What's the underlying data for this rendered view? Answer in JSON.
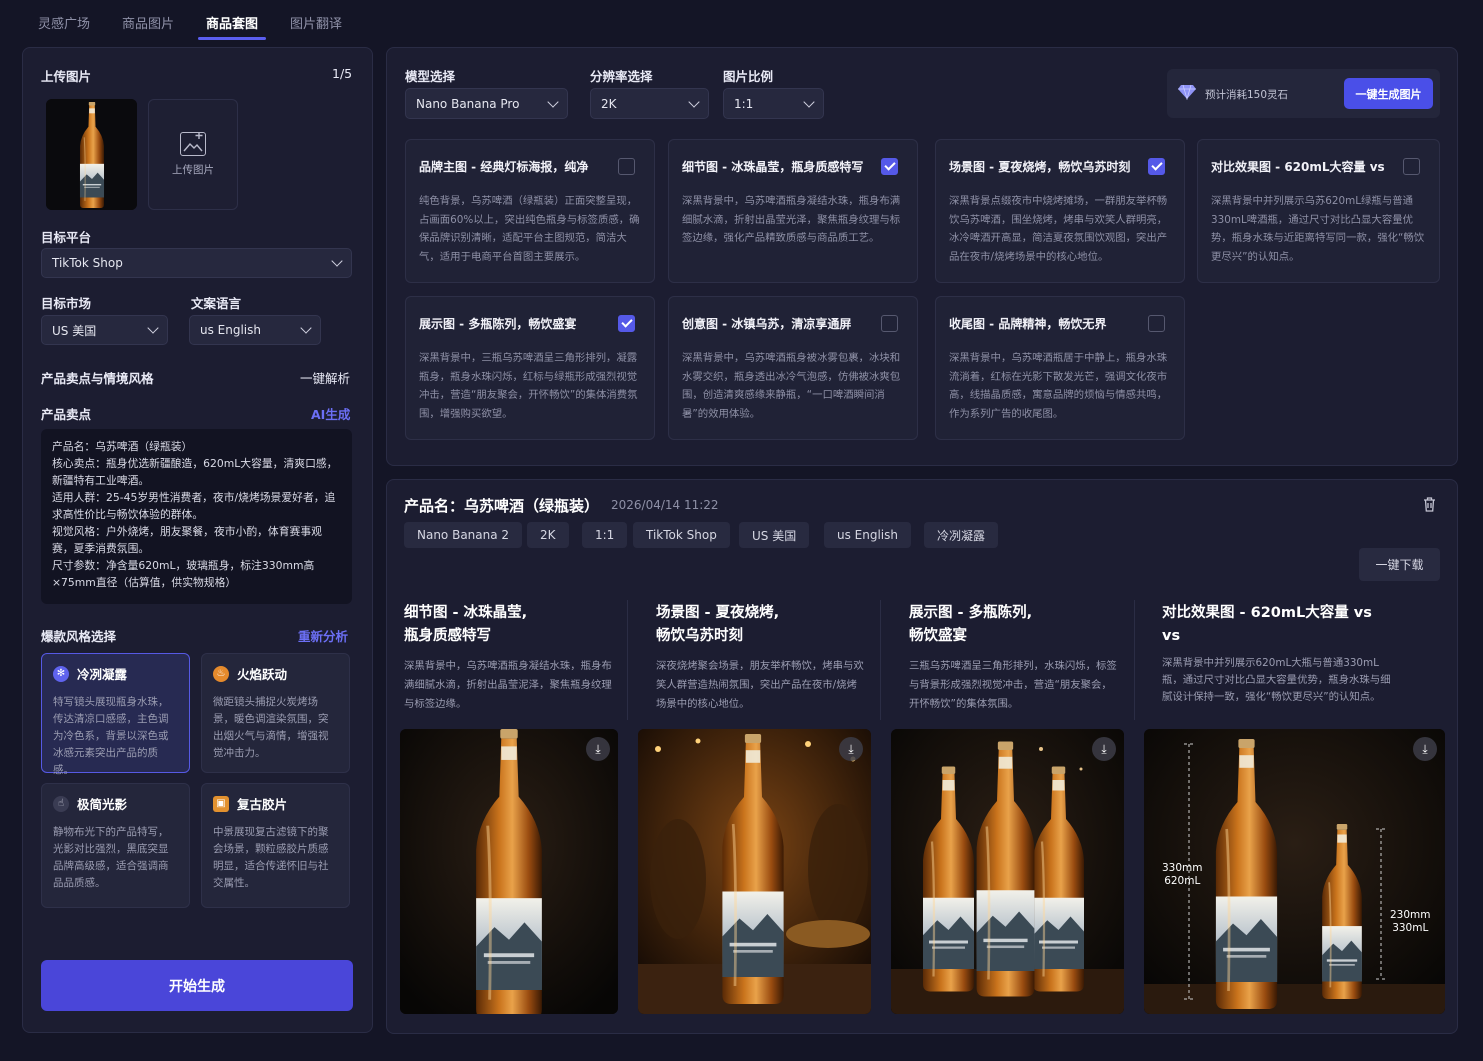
{
  "tabs": [
    "灵感广场",
    "商品图片",
    "商品套图",
    "图片翻译"
  ],
  "left": {
    "upload_title": "上传图片",
    "upload_count": "1/5",
    "upload_box_label": "上传图片",
    "platform_label": "目标平台",
    "platform_value": "TikTok Shop",
    "market_label": "目标市场",
    "market_value": "US 美国",
    "lang_label": "文案语言",
    "lang_value": "us English",
    "selling_style_label": "产品卖点与情境风格",
    "parse_link": "一键解析",
    "selling_points_label": "产品卖点",
    "ai_link": "AI生成",
    "selling_points_text": "产品名：乌苏啤酒（绿瓶装）\n核心卖点：瓶身优选新疆酿造，620mL大容量，清爽口感，新疆特有工业啤酒。\n适用人群：25-45岁男性消费者，夜市/烧烤场景爱好者，追求高性价比与畅饮体验的群体。\n视觉风格：户外烧烤，朋友聚餐，夜市小酌，体育赛事观赛，夏季消费氛围。\n尺寸参数：净含量620mL，玻璃瓶身，标注330mm高×75mm直径（估算值，供实物规格）",
    "style_label": "爆款风格选择",
    "reanalyze_link": "重新分析",
    "styles": [
      {
        "title": "冷冽凝露",
        "desc": "特写镜头展现瓶身水珠，传达清凉口感感，主色调为冷色系，背景以深色或冰感元素突出产品的质感。"
      },
      {
        "title": "火焰跃动",
        "desc": "微距镜头捕捉火炭烤场景，暖色调渲染氛围，突出烟火气与滴情，增强视觉冲击力。"
      },
      {
        "title": "极简光影",
        "desc": "静物布光下的产品特写，光影对比强烈，黑底突显品牌高级感，适合强调商品品质感。"
      },
      {
        "title": "复古胶片",
        "desc": "中景展现复古滤镜下的聚会场景，颗粒感胶片质感明显，适合传递怀旧与社交属性。"
      }
    ],
    "generate_button": "开始生成"
  },
  "config": {
    "model_label": "模型选择",
    "model_value": "Nano Banana Pro",
    "res_label": "分辨率选择",
    "res_value": "2K",
    "ratio_label": "图片比例",
    "ratio_value": "1:1",
    "cost_text": "预计消耗150灵石",
    "cost_button": "一键生成图片"
  },
  "options": [
    {
      "title": "品牌主图 - 经典灯标海报，纯净",
      "desc": "纯色背景，乌苏啤酒（绿瓶装）正面突整呈现，占画面60%以上，突出纯色瓶身与标签质感，确保品牌识别清晰，适配平台主图规范，简洁大气，适用于电商平台首图主要展示。",
      "checked": false
    },
    {
      "title": "细节图 - 冰珠晶莹，瓶身质感特写",
      "desc": "深黑背景中，乌苏啤酒瓶身凝结水珠，瓶身布满细腻水滴，折射出晶莹光泽，聚焦瓶身纹理与标签边缘，强化产品精致质感与商品质工艺。",
      "checked": true
    },
    {
      "title": "场景图 - 夏夜烧烤，畅饮乌苏时刻",
      "desc": "深黑背景点缀夜市中烧烤摊场，一群朋友举杯畅饮乌苏啤酒，围坐烧烤，烤串与欢笑人群明亮，冰冷啤酒开高显，简洁夏夜氛围饮观图，突出产品在夜市/烧烤场景中的核心地位。",
      "checked": true
    },
    {
      "title": "对比效果图 - 620mL大容量 vs",
      "desc": "深黑背景中并列展示乌苏620mL绿瓶与普通330mL啤酒瓶，通过尺寸对比凸显大容量优势，瓶身水珠与近距离特写同一款，强化“畅饮更尽兴”的认知点。",
      "checked": false
    },
    {
      "title": "展示图 - 多瓶陈列，畅饮盛宴",
      "desc": "深黑背景中，三瓶乌苏啤酒呈三角形排列，凝露瓶身，瓶身水珠闪烁，红标与绿瓶形成强烈视觉冲击，营造“朋友聚会，开怀畅饮”的集体消费氛围，增强购买欲望。",
      "checked": true
    },
    {
      "title": "创意图 - 冰镇乌苏，清凉享通屏",
      "desc": "深黑背景中，乌苏啤酒瓶身被冰雾包裹，冰块和水雾交织，瓶身透出冰冷气泡感，仿佛被冰爽包围，创造清爽感缘来静瓶，“一口啤酒瞬间消暑”的效用体验。",
      "checked": false
    },
    {
      "title": "收尾图 - 品牌精神，畅饮无界",
      "desc": "深黑背景中，乌苏啤酒瓶居于中静上，瓶身水珠流淌着，红标在光影下散发光芒，强调文化夜市高，线描晶质感，寓意品牌的烦恼与情感共鸣，作为系列广告的收尾图。",
      "checked": false
    }
  ],
  "result": {
    "product_title": "产品名：乌苏啤酒（绿瓶装）",
    "date": "2026/04/14 11:22",
    "chips": [
      "Nano Banana 2",
      "2K",
      "1:1",
      "TikTok Shop",
      "US 美国",
      "us English",
      "冷冽凝露"
    ],
    "download_all": "一键下载",
    "columns": [
      {
        "title1": "细节图 - 冰珠晶莹,",
        "title2": "瓶身质感特写",
        "desc": "深黑背景中，乌苏啤酒瓶身凝结水珠，瓶身布满细腻水滴，折射出晶莹泥泽，聚焦瓶身纹理与标签边缘。"
      },
      {
        "title1": "场景图 - 夏夜烧烤,",
        "title2": "畅饮乌苏时刻",
        "desc": "深夜烧烤聚会场景，朋友举杯畅饮，烤串与欢笑人群营造热闹氛围，突出产品在夜市/烧烤场景中的核心地位。"
      },
      {
        "title1": "展示图 - 多瓶陈列,",
        "title2": "畅饮盛宴",
        "desc": "三瓶乌苏啤酒呈三角形排列，水珠闪烁，标签与背景形成强烈视觉冲击，营造“朋友聚会，开怀畅饮”的集体氛围。"
      },
      {
        "title1": "对比效果图 - 620mL大容量 vs",
        "title2": "vs",
        "desc": "深黑背景中并列展示620mL大瓶与普通330mL瓶，通过尺寸对比凸显大容量优势，瓶身水珠与细腻设计保持一致，强化“畅饮更尽兴”的认知点。"
      }
    ],
    "label_main": "Mountain Mist & Wildflower IPA",
    "dim_left_1": "330mm",
    "dim_left_2": "620mL",
    "dim_right_1": "230mm",
    "dim_right_2": "330mL"
  }
}
